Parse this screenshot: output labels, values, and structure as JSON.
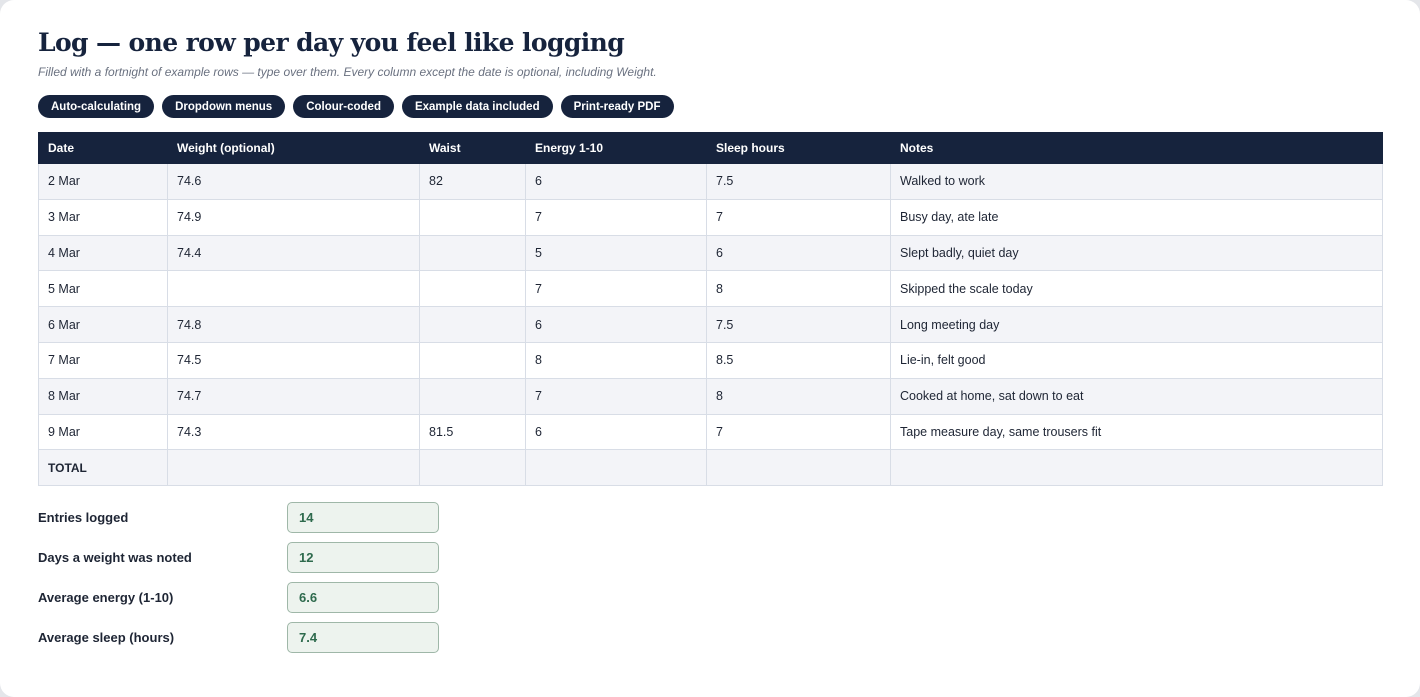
{
  "header": {
    "title": "Log — one row per day you feel like logging",
    "subtitle": "Filled with a fortnight of example rows — type over them. Every column except the date is optional, including Weight."
  },
  "badges": [
    "Auto-calculating",
    "Dropdown menus",
    "Colour-coded",
    "Example data included",
    "Print-ready PDF"
  ],
  "table": {
    "columns": [
      "Date",
      "Weight (optional)",
      "Waist",
      "Energy 1-10",
      "Sleep hours",
      "Notes"
    ],
    "rows": [
      [
        "2 Mar",
        "74.6",
        "82",
        "6",
        "7.5",
        "Walked to work"
      ],
      [
        "3 Mar",
        "74.9",
        "",
        "7",
        "7",
        "Busy day, ate late"
      ],
      [
        "4 Mar",
        "74.4",
        "",
        "5",
        "6",
        "Slept badly, quiet day"
      ],
      [
        "5 Mar",
        "",
        "",
        "7",
        "8",
        "Skipped the scale today"
      ],
      [
        "6 Mar",
        "74.8",
        "",
        "6",
        "7.5",
        "Long meeting day"
      ],
      [
        "7 Mar",
        "74.5",
        "",
        "8",
        "8.5",
        "Lie-in, felt good"
      ],
      [
        "8 Mar",
        "74.7",
        "",
        "7",
        "8",
        "Cooked at home, sat down to eat"
      ],
      [
        "9 Mar",
        "74.3",
        "81.5",
        "6",
        "7",
        "Tape measure day, same trousers fit"
      ]
    ],
    "total_label": "TOTAL"
  },
  "summary": [
    {
      "label": "Entries logged",
      "value": "14"
    },
    {
      "label": "Days a weight was noted",
      "value": "12"
    },
    {
      "label": "Average energy (1-10)",
      "value": "6.6"
    },
    {
      "label": "Average sleep (hours)",
      "value": "7.4"
    }
  ],
  "colors": {
    "navy": "#16233d",
    "row_stripe": "#f3f4f8",
    "summary_fill": "#edf3ee",
    "summary_text": "#2e6a4d"
  }
}
